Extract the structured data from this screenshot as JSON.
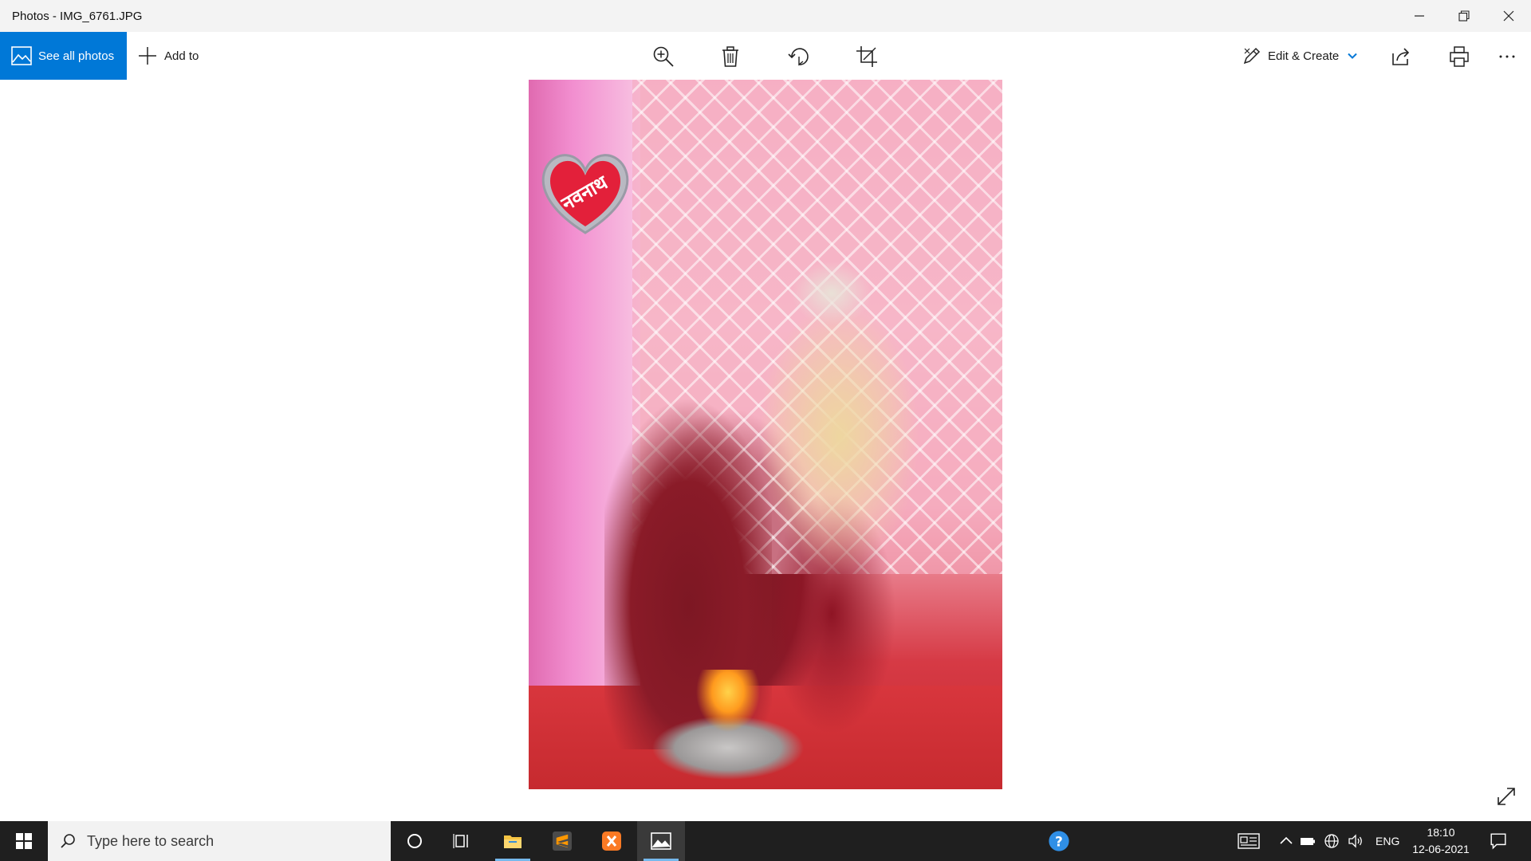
{
  "window": {
    "title": "Photos - IMG_6761.JPG",
    "controls": [
      "minimize-icon",
      "restore-icon",
      "close-icon"
    ]
  },
  "toolbar": {
    "see_all_label": "See all photos",
    "add_to_label": "Add to",
    "tools": [
      "zoom-in-icon",
      "delete-icon",
      "rotate-icon",
      "crop-icon"
    ],
    "edit_create_label": "Edit & Create",
    "right_icons": [
      "share-icon",
      "print-icon",
      "more-icon"
    ],
    "accent_color": "#0078d7"
  },
  "photo": {
    "heart_text": "नवनाथ"
  },
  "taskbar": {
    "search_placeholder": "Type here to search",
    "apps": [
      "cortana-icon",
      "task-view-icon",
      "file-explorer-icon",
      "sublime-text-icon",
      "xampp-icon",
      "photos-icon"
    ],
    "active_app": "photos-icon",
    "tray_icons": [
      "help-icon",
      "news-icon",
      "chevron-up-icon",
      "battery-icon",
      "network-icon",
      "volume-icon"
    ],
    "language": "ENG",
    "time": "18:10",
    "date": "12-06-2021",
    "notification_icon": "action-center-icon"
  }
}
